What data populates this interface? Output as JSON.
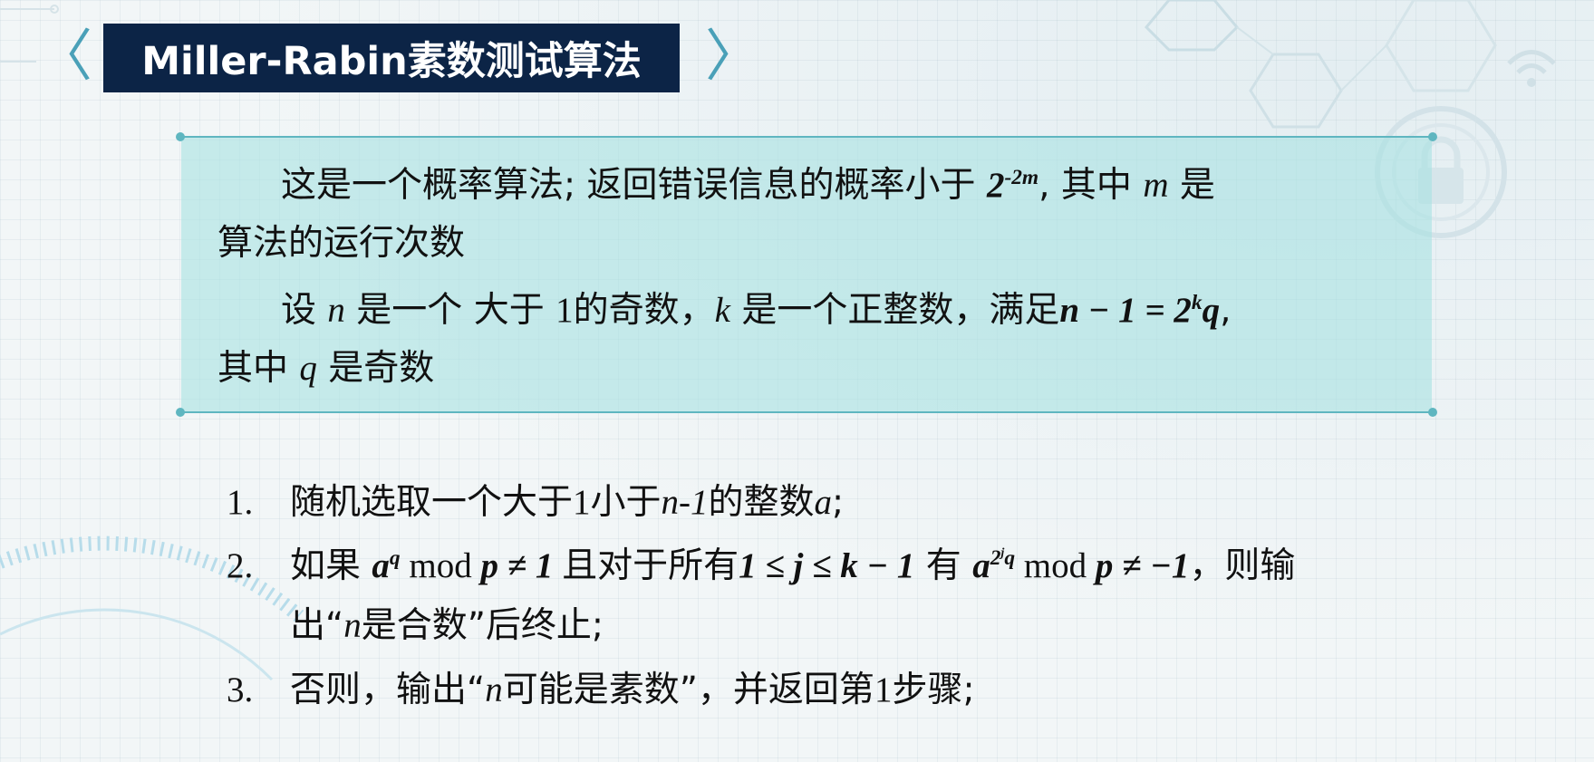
{
  "header": {
    "title": "Miller-Rabin素数测试算法",
    "prev_glyph": "〈",
    "next_glyph": "〉"
  },
  "definition": {
    "p1_a": "这是一个概率算法; 返回错误信息的概率小于 ",
    "p1_base": "2",
    "p1_exp": "-2m",
    "p1_b": ", 其中 ",
    "p1_var": "m",
    "p1_c": " 是",
    "p1_line2": "算法的运行次数",
    "p2_a": "设 ",
    "p2_n": "n",
    "p2_b": " 是一个 大于 ",
    "p2_one": "1",
    "p2_c": "的奇数，",
    "p2_k": "k",
    "p2_d": " 是一个正整数，满足",
    "p2_eq": "n − 1 = 2",
    "p2_eq_exp": "k",
    "p2_eq_q": "q",
    "p2_e": ",",
    "p2_line2_a": "其中 ",
    "p2_q": "q",
    "p2_line2_b": " 是奇数"
  },
  "steps": [
    {
      "num": "1.",
      "a": "随机选取一个大于",
      "one": "1",
      "b": "小于",
      "nm1": "n-1",
      "c": "的整数",
      "avar": "a",
      "d": ";"
    },
    {
      "num": "2.",
      "a": "如果 ",
      "aq": "a",
      "aq_exp": "q",
      "mod1": " mod ",
      "p1": "p",
      "neq1": " ≠ 1 ",
      "b": "且对于所有",
      "cond": "1 ≤ j ≤ k − 1",
      "c": " 有 ",
      "a2": "a",
      "a2_exp": "2",
      "a2_exp2": "j",
      "a2_q": "q",
      "mod2": " mod ",
      "p2": "p",
      "neq2": " ≠ −1",
      "d": "，则输",
      "line2_a": "出“",
      "line2_n": "n",
      "line2_b": "是合数”后终止;"
    },
    {
      "num": "3.",
      "a": "否则，输出“",
      "n": "n",
      "b": "可能是素数”，并返回第",
      "one": "1",
      "c": "步骤;"
    }
  ],
  "colors": {
    "title_bg": "#0c2446",
    "chevron": "#4aa0b8",
    "box_fill": "#aee2e2",
    "box_border": "#5fb6c0"
  }
}
